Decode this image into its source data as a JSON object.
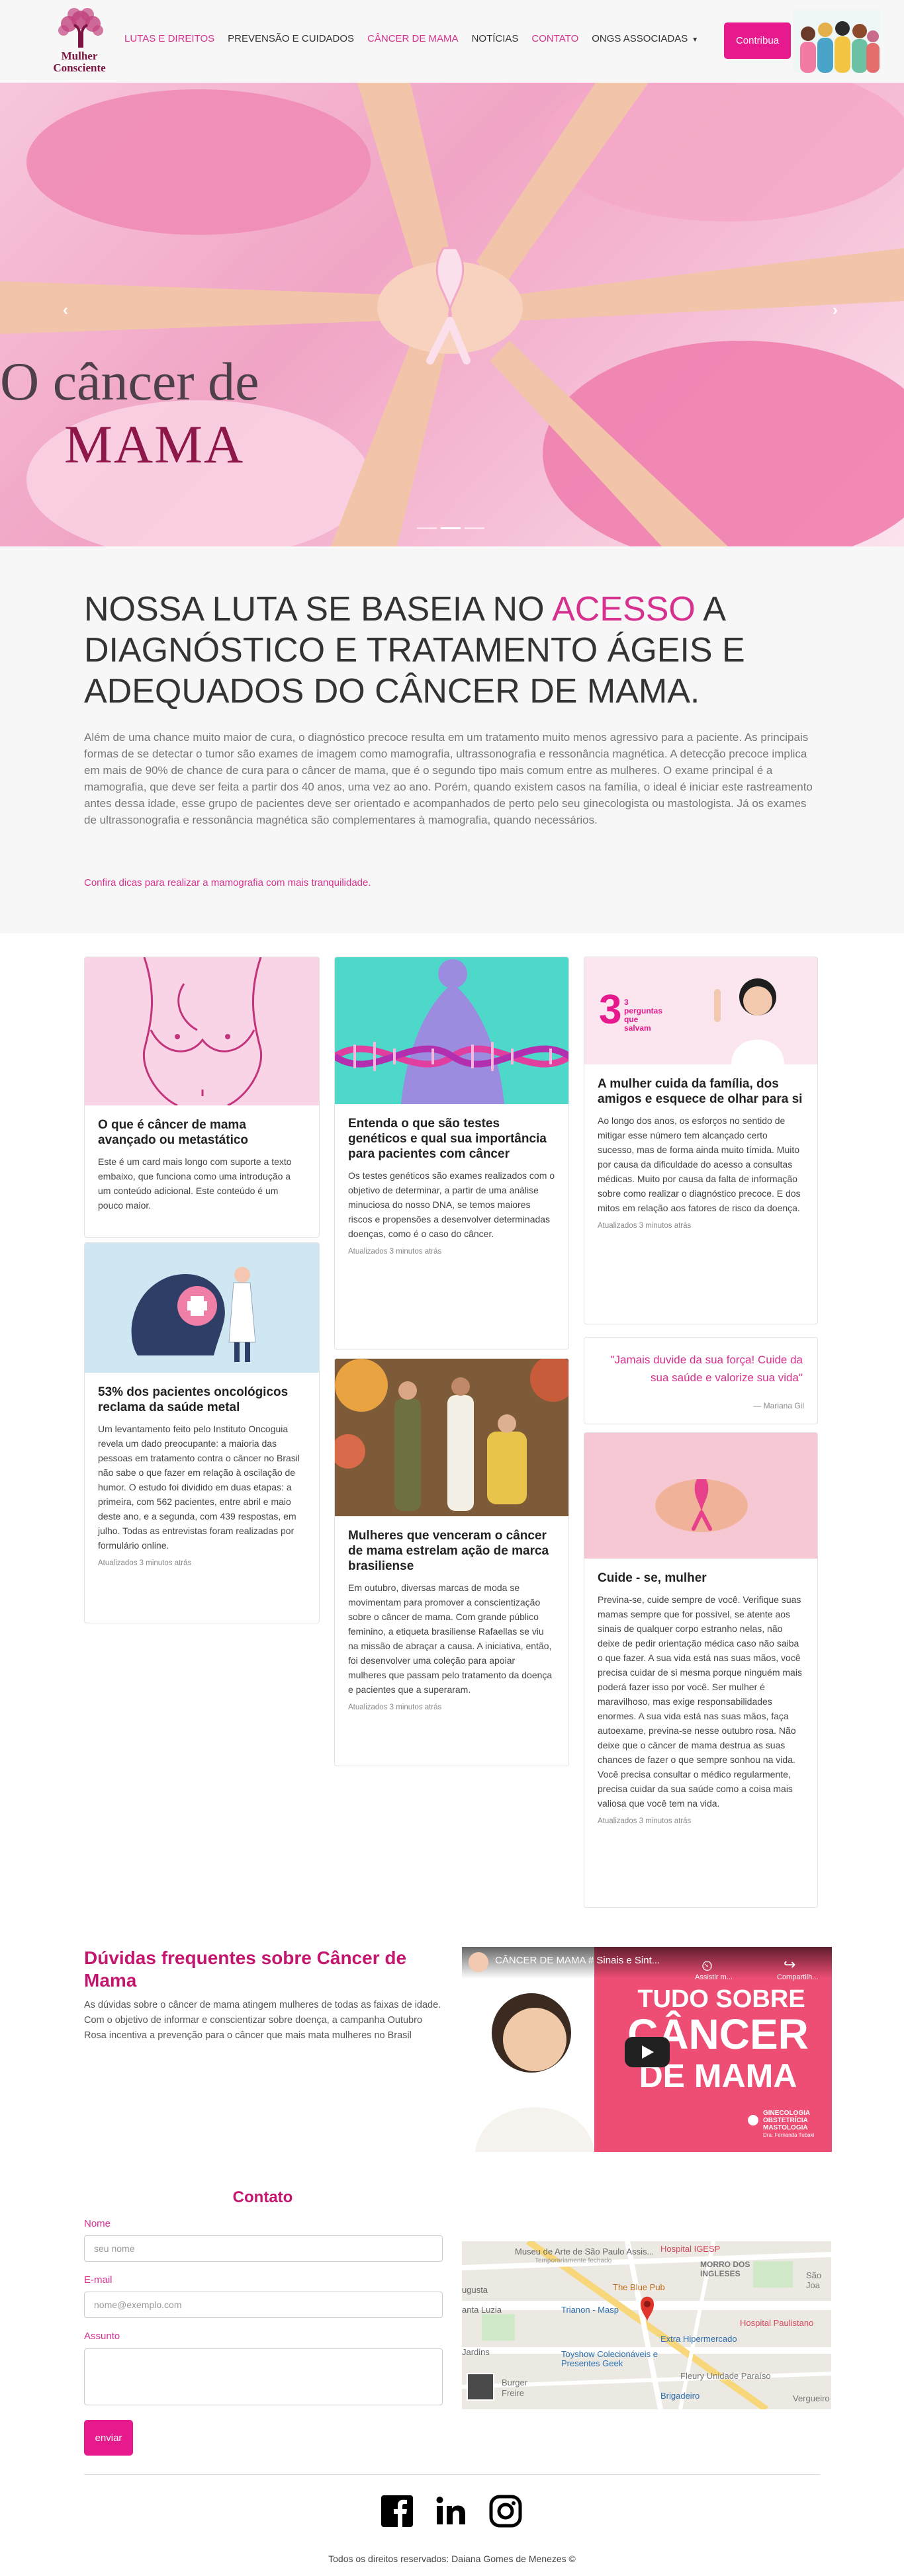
{
  "brand": {
    "logo_line1": "Mulher",
    "logo_line2": "Consciente"
  },
  "nav": {
    "items": [
      "LUTAS E DIREITOS",
      "PREVENSÃO E CUIDADOS",
      "CÂNCER DE MAMA",
      "NOTÍCIAS",
      "CONTATO",
      "ONGS ASSOCIADAS"
    ],
    "contribute_label": "Contribua"
  },
  "hero": {
    "title_line1": "O câncer de",
    "title_line2": "MAMA",
    "prev": "‹",
    "next": "›"
  },
  "mission": {
    "heading_before": "NOSSA LUTA SE BASEIA NO ",
    "heading_accent": "ACESSO",
    "heading_after": " A DIAGNÓSTICO E TRATAMENTO ÁGEIS E ADEQUADOS DO CÂNCER DE MAMA.",
    "body": "Além de uma chance muito maior de cura, o diagnóstico precoce resulta em um tratamento muito menos agressivo para a paciente. As principais formas de se detectar o tumor são exames de imagem como mamografia, ultrassonografia e ressonância magnética. A detecção precoce implica em mais de 90% de chance de cura para o câncer de mama, que é o segundo tipo mais comum entre as mulheres. O exame principal é a mamografia, que deve ser feita a partir dos 40 anos, uma vez ao ano. Porém, quando existem casos na família, o ideal é iniciar este rastreamento antes dessa idade, esse grupo de pacientes deve ser orientado e acompanhados de perto pelo seu ginecologista ou mastologista. Já os exames de ultrassonografia e ressonância magnética são complementares à mamografia, quando necessários.",
    "link": "Confira dicas para realizar a mamografia com mais tranquilidade."
  },
  "cards": {
    "c1": {
      "title": "O que é câncer de mama avançado ou metastático",
      "text": "Este é um card mais longo com suporte a texto embaixo, que funciona como uma introdução a um conteúdo adicional. Este conteúdo é um pouco maior."
    },
    "c2": {
      "title": "53% dos pacientes oncológicos reclama da saúde metal",
      "text": "Um levantamento feito pelo Instituto Oncoguia revela um dado preocupante: a maioria das pessoas em tratamento contra o câncer no Brasil não sabe o que fazer em relação à oscilação de humor. O estudo foi dividido em duas etapas: a primeira, com 562 pacientes, entre abril e maio deste ano, e a segunda, com 439 respostas, em julho. Todas as entrevistas foram realizadas por formulário online.",
      "updated": "Atualizados 3 minutos atrás"
    },
    "c3": {
      "title": "Entenda o que são testes genéticos e qual sua importância para pacientes com câncer",
      "text": "Os testes genéticos são exames realizados com o objetivo de determinar, a partir de uma análise minuciosa do nosso DNA, se temos maiores riscos e propensões a desenvolver determinadas doenças, como é o caso do câncer.",
      "updated": "Atualizados 3 minutos atrás"
    },
    "c4": {
      "title": "Mulheres que venceram o câncer de mama estrelam ação de marca brasiliense",
      "text": "Em outubro, diversas marcas de moda se movimentam para promover a conscientização sobre o câncer de mama. Com grande público feminino, a etiqueta brasiliense Rafaellas se viu na missão de abraçar a causa. A iniciativa, então, foi desenvolver uma coleção para apoiar mulheres que passam pelo tratamento da doença e pacientes que a superaram.",
      "updated": "Atualizados 3 minutos atrás"
    },
    "c5": {
      "title": "A mulher cuida da família, dos amigos e esquece de olhar para si",
      "text": "Ao longo dos anos, os esforços no sentido de mitigar esse número tem alcançado certo sucesso, mas de forma ainda muito tímida. Muito por causa da dificuldade do acesso a consultas médicas. Muito por causa da falta de informação sobre como realizar o diagnóstico precoce. E dos mitos em relação aos fatores de risco da doença.",
      "updated": "Atualizados 3 minutos atrás",
      "image_text": "3 perguntas que salvam"
    },
    "c6": {
      "title": "Cuide - se, mulher",
      "text": "Previna-se, cuide sempre de você. Verifique suas mamas sempre que for possível, se atente aos sinais de qualquer corpo estranho nelas, não deixe de pedir orientação médica caso não saiba o que fazer. A sua vida está nas suas mãos, você precisa cuidar de si mesma porque ninguém mais poderá fazer isso por você. Ser mulher é maravilhoso, mas exige responsabilidades enormes. A sua vida está nas suas mãos, faça autoexame, previna-se nesse outubro rosa. Não deixe que o câncer de mama destrua as suas chances de fazer o que sempre sonhou na vida. Você precisa consultar o médico regularmente, precisa cuidar da sua saúde como a coisa mais valiosa que você tem na vida.",
      "updated": "Atualizados 3 minutos atrás"
    }
  },
  "quote": {
    "text": "\"Jamais duvide da sua força! Cuide da sua saúde e valorize sua vida\"",
    "author": "— Mariana Gil"
  },
  "faq": {
    "title": "Dúvidas frequentes sobre Câncer de Mama",
    "text": "As dúvidas sobre o câncer de mama atingem mulheres de todas as faixas de idade. Com o objetivo de informar e conscientizar sobre doença, a campanha Outubro Rosa incentiva a prevenção para o câncer que mais mata mulheres no Brasil"
  },
  "video": {
    "title": "CÂNCER DE MAMA # Sinais e Sint...",
    "watch_later": "Assistir m...",
    "share": "Compartilh...",
    "thumb_line1": "TUDO SOBRE",
    "thumb_line2": "CÂNCER",
    "thumb_line3": "DE MAMA",
    "brand_line1": "GINECOLOGIA",
    "brand_line2": "OBSTETRÍCIA",
    "brand_line3": "MASTOLOGIA",
    "doctor": "Dra. Fernanda Tubaki"
  },
  "contact": {
    "title": "Contato",
    "name_label": "Nome",
    "name_placeholder": "seu nome",
    "email_label": "E-mail",
    "email_placeholder": "nome@exemplo.com",
    "subject_label": "Assunto",
    "send_label": "enviar"
  },
  "map": {
    "labels": [
      "Museu de Arte de São Paulo Assis...",
      "Temporariamente fechado",
      "Hospital IGESP",
      "MORRO DOS INGLESES",
      "São Joa",
      "The Blue Pub",
      "ugusta",
      "anta Luzia",
      "Trianon - Masp",
      "Hospital Paulistano",
      "Extra Hipermercado",
      "Toyshow Colecionáveis e Presentes Geek",
      "Fleury Unidade Paraíso",
      "Jardins",
      "Burger",
      "Freire",
      "Brigadeiro",
      "Vergueiro"
    ]
  },
  "footer": {
    "text": "Todos os direitos reservados: Daiana Gomes de Menezes ©"
  },
  "colors": {
    "accent": "#e6198d",
    "dark_accent": "#8c1748"
  }
}
